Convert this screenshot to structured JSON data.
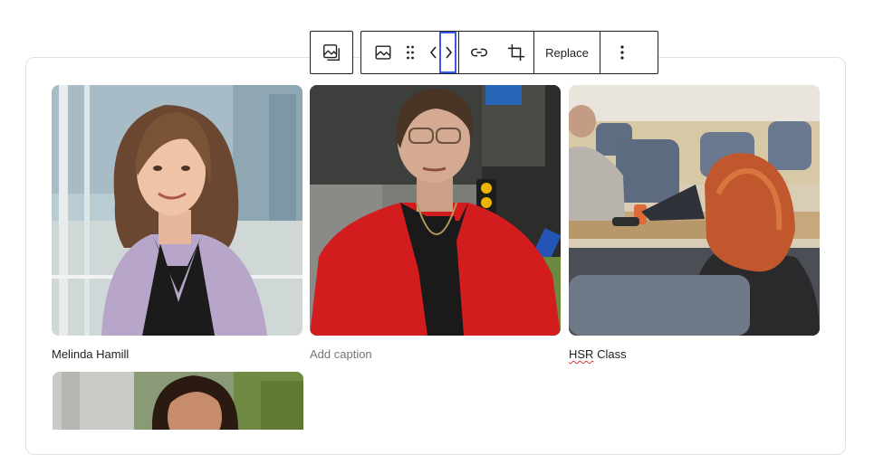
{
  "toolbar": {
    "parent_button": {
      "icon": "gallery-parent-icon"
    },
    "image_type_icon": "image-icon",
    "drag_handle_icon": "drag-handle-icon",
    "move_left_icon": "chevron-left-icon",
    "move_right_icon": "chevron-right-icon",
    "link_icon": "link-icon",
    "crop_icon": "crop-icon",
    "replace_label": "Replace",
    "more_icon": "more-vertical-icon"
  },
  "gallery": {
    "images": [
      {
        "caption": "Melinda Hamill",
        "caption_is_placeholder": false
      },
      {
        "caption": "Add caption",
        "caption_is_placeholder": true
      },
      {
        "caption_prefix": "HSR",
        "caption_suffix": " Class",
        "caption_is_placeholder": false
      },
      {
        "caption": "",
        "caption_is_placeholder": false
      }
    ]
  },
  "colors": {
    "focus_blue": "#3858e9",
    "toolbar_border": "#1e1e1e",
    "caption_placeholder": "#757575",
    "block_border": "#e0e0e0"
  }
}
